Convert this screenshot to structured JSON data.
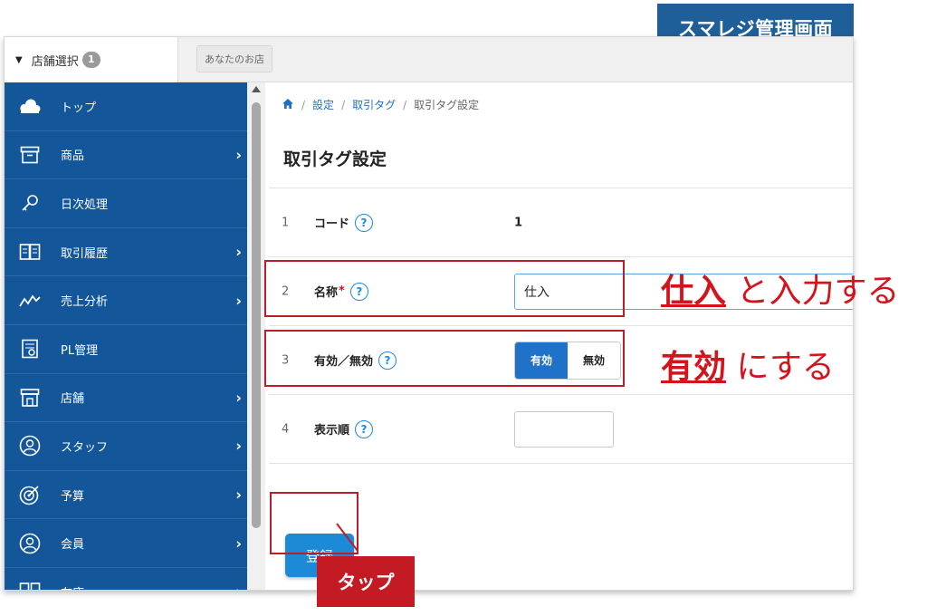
{
  "brand_badge": "スマレジ管理画面",
  "topbar": {
    "store_select_label": "店舗選択",
    "store_count": "1",
    "store_name": "あなたのお店"
  },
  "sidebar": {
    "items": [
      {
        "label": "トップ",
        "icon": "cloud-icon"
      },
      {
        "label": "商品",
        "icon": "box-icon"
      },
      {
        "label": "日次処理",
        "icon": "key-icon"
      },
      {
        "label": "取引履歴",
        "icon": "book-icon"
      },
      {
        "label": "売上分析",
        "icon": "trend-icon"
      },
      {
        "label": "PL管理",
        "icon": "report-icon"
      },
      {
        "label": "店舗",
        "icon": "store-icon"
      },
      {
        "label": "スタッフ",
        "icon": "staff-icon"
      },
      {
        "label": "予算",
        "icon": "target-icon"
      },
      {
        "label": "会員",
        "icon": "member-icon"
      },
      {
        "label": "在庫",
        "icon": "inventory-icon"
      }
    ]
  },
  "breadcrumb": {
    "items": [
      "設定",
      "取引タグ",
      "取引タグ設定"
    ]
  },
  "page_title": "取引タグ設定",
  "form": {
    "rows": [
      {
        "num": "1",
        "label": "コード",
        "value": "1"
      },
      {
        "num": "2",
        "label": "名称",
        "required_mark": "*",
        "value": "仕入"
      },
      {
        "num": "3",
        "label": "有効／無効",
        "options": [
          "有効",
          "無効"
        ],
        "selected": "有効"
      },
      {
        "num": "4",
        "label": "表示順",
        "value": ""
      }
    ],
    "help_glyph": "?",
    "submit_label": "登録"
  },
  "annotations": {
    "name_key": "仕入",
    "name_rest": " と入力する",
    "valid_key": "有効",
    "valid_rest": " にする",
    "tap": "タップ",
    "color": "#d4141c"
  }
}
